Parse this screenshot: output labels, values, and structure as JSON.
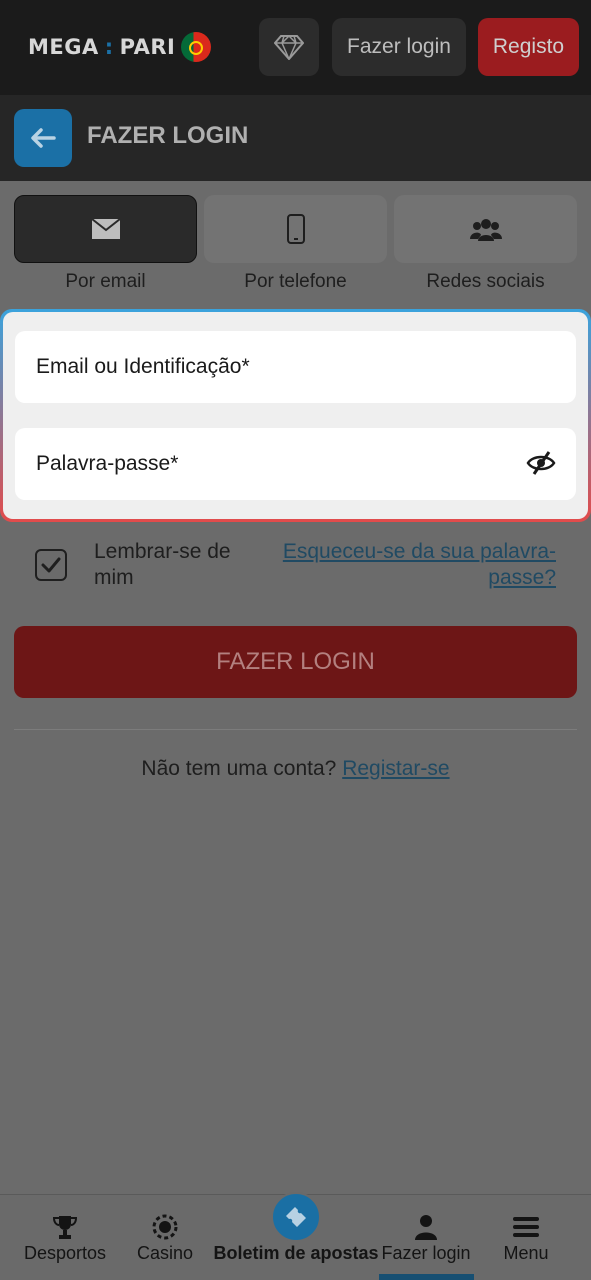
{
  "header": {
    "logo_text": "MEGA",
    "logo_text2": "PARI",
    "login_label": "Fazer login",
    "register_label": "Registo"
  },
  "page": {
    "title": "FAZER LOGIN"
  },
  "tabs": [
    {
      "label": "Por email",
      "icon": "envelope-icon",
      "active": true
    },
    {
      "label": "Por telefone",
      "icon": "phone-icon",
      "active": false
    },
    {
      "label": "Redes sociais",
      "icon": "users-icon",
      "active": false
    }
  ],
  "form": {
    "email_placeholder": "Email ou Identificação*",
    "password_placeholder": "Palavra-passe*",
    "remember_label": "Lembrar-se de mim",
    "remember_checked": true,
    "forgot_label": "Esqueceu-se da sua palavra-passe?",
    "submit_label": "FAZER LOGIN",
    "no_account_text": "Não tem uma conta?",
    "signup_link": "Registar-se"
  },
  "bottom_nav": [
    {
      "label": "Desportos",
      "icon": "trophy-icon"
    },
    {
      "label": "Casino",
      "icon": "casino-chip-icon"
    },
    {
      "label": "Boletim de apostas",
      "icon": "ticket-icon"
    },
    {
      "label": "Fazer login",
      "icon": "user-icon",
      "active": true
    },
    {
      "label": "Menu",
      "icon": "hamburger-icon"
    }
  ],
  "colors": {
    "accent_blue": "#1b70a6",
    "brand_red": "#9b1c1f"
  }
}
